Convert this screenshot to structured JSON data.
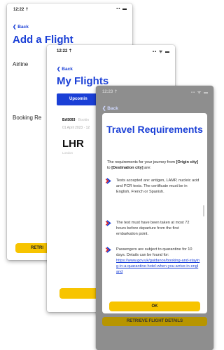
{
  "screen1": {
    "status_time": "12:22 ⇡",
    "status_icons": "▪▪ ▬",
    "back": "Back",
    "title": "Add a Flight",
    "airline_label": "Airline",
    "booking_label": "Booking Re",
    "retrieve_button": "RETRI"
  },
  "screen2": {
    "status_time": "12:22 ⇡",
    "status_icons": "▪▪ ᯤ ▬",
    "back": "Back",
    "title": "My Flights",
    "tab_label": "Upcomin",
    "flight_code": "BA5093",
    "flight_suffix": "· Bookin",
    "flight_date": "01 April 2023 · 12",
    "airport_code": "LHR",
    "airport_name": "London",
    "button_fragment": "A"
  },
  "screen3": {
    "status_time": "12:23 ⇡",
    "status_icons": "▪▪ ᯤ ▬",
    "back": "Back",
    "bottom_button": "RETRIEVE FLIGHT DETAILS",
    "modal": {
      "title": "Travel Requirements",
      "intro": {
        "pre": "The requirements for your journey from ",
        "origin": "[Origin city]",
        "mid": " to ",
        "destination": "[Destination city]",
        "post": " are:"
      },
      "requirements": [
        {
          "text": "Tests accepted are: antigen, LAMP, nucleic acid and PCR tests. The certificate must be in English, French or Spanish."
        },
        {
          "text": "The test must have been taken at most 72 hours before departure from the first embarkation point."
        },
        {
          "text": "Passengers are subject to quarantine for 10 days. Details can be found for:",
          "link": "https://www.gov.uk/guidance/booking-and-staying-in-a-quarantine-hotel-when-you-arrive-in-england"
        }
      ],
      "ok_button": "OK"
    }
  },
  "colors": {
    "brand_blue": "#1a3fd6",
    "button_yellow": "#f7c400",
    "arrow_red": "#e02020"
  }
}
